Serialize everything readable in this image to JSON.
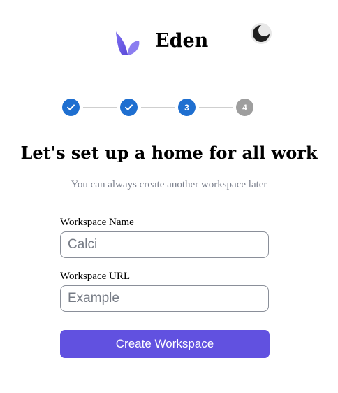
{
  "brand": {
    "name": "Eden",
    "logo_icon": "eden-logo-icon",
    "logo_colors": [
      "#6a5be6",
      "#8b7df0"
    ]
  },
  "theme_toggle": {
    "icon": "moon-icon"
  },
  "stepper": {
    "current_step": 3,
    "total_steps": 4,
    "steps": [
      {
        "label": "",
        "state": "done",
        "icon": "check-icon"
      },
      {
        "label": "",
        "state": "done",
        "icon": "check-icon"
      },
      {
        "label": "3",
        "state": "active"
      },
      {
        "label": "4",
        "state": "pending"
      }
    ],
    "colors": {
      "done": "#1f6fd0",
      "active": "#1f6fd0",
      "pending": "#9e9e9e"
    }
  },
  "main": {
    "title": "Let's set up a home for all work",
    "subtitle": "You can always create another workspace later"
  },
  "form": {
    "workspace_name": {
      "label": "Workspace Name",
      "placeholder": "Calci",
      "value": ""
    },
    "workspace_url": {
      "label": "Workspace URL",
      "placeholder": "Example",
      "value": ""
    },
    "submit_label": "Create Workspace",
    "submit_color": "#6151e0"
  }
}
